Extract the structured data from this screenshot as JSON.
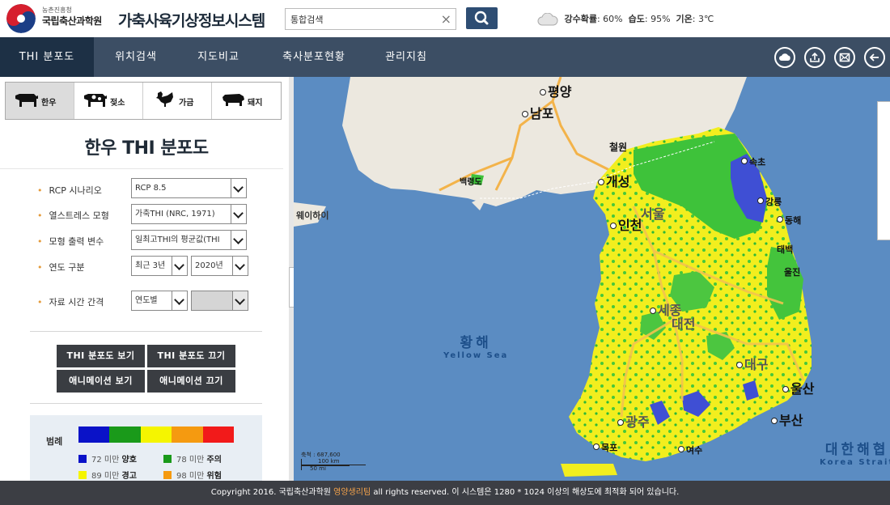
{
  "header": {
    "org_parent": "농촌진흥청",
    "org_name": "국립축산과학원",
    "system_title": "가축사육기상정보시스템",
    "search_value": "통합검색",
    "weather": {
      "precip_label": "강수확률",
      "precip_value": ": 60%",
      "humidity_label": "습도",
      "humidity_value": ": 95%",
      "temp_label": "기온",
      "temp_value": ": 3℃"
    }
  },
  "nav": {
    "tabs": [
      {
        "label": "THI 분포도"
      },
      {
        "label": "위치검색"
      },
      {
        "label": "지도비교"
      },
      {
        "label": "축사분포현황"
      },
      {
        "label": "관리지침"
      }
    ]
  },
  "sidebar": {
    "animals": [
      {
        "label": "한우"
      },
      {
        "label": "젖소"
      },
      {
        "label": "가금"
      },
      {
        "label": "돼지"
      }
    ],
    "panel_title": "한우 THI 분포도",
    "fields": {
      "rcp_label": "RCP 시나리오",
      "rcp_value": "RCP 8.5",
      "stress_label": "열스트레스 모형",
      "stress_value": "가축THI (NRC, 1971)",
      "output_label": "모형 출력 변수",
      "output_value": "일최고THI의 평균값(THI",
      "year_label": "연도 구분",
      "year_range_value": "최근 3년",
      "year_value": "2020년",
      "interval_label": "자료 시간 간격",
      "interval_value": "연도별",
      "interval_sub_value": ""
    },
    "buttons": {
      "show_thi": "THI 분포도 보기",
      "hide_thi": "THI 분포도 끄기",
      "show_anim": "애니메이션 보기",
      "hide_anim": "애니메이션 끄기"
    },
    "legend": {
      "label": "범례",
      "colors": [
        "#0a12c8",
        "#1a9a1a",
        "#f5f500",
        "#f59a10",
        "#f21a1a"
      ],
      "items": [
        {
          "text": "72 미만",
          "level": "양호",
          "color": "#0a12c8"
        },
        {
          "text": "78 미만",
          "level": "주의",
          "color": "#1a9a1a"
        },
        {
          "text": "89 미만",
          "level": "경고",
          "color": "#f5f500"
        },
        {
          "text": "98 미만",
          "level": "위험",
          "color": "#f59a10"
        }
      ]
    }
  },
  "map": {
    "places": {
      "pyongyang": "평양",
      "nampo": "남포",
      "cheorwon": "철원",
      "baengnyeong": "백령도",
      "kaesong": "개성",
      "sokcho": "속초",
      "gangneung": "강릉",
      "donghae": "동해",
      "incheon": "인천",
      "seoul": "서울",
      "weihai": "웨이하이",
      "taebaek": "태백",
      "uljin": "울진",
      "sejong": "세종",
      "daejeon": "대전",
      "daegu": "대구",
      "ulsan": "울산",
      "busan": "부산",
      "gwangju": "광주",
      "mokpo": "목포",
      "yeosu": "여수"
    },
    "seas": {
      "yellow_ko": "황해",
      "yellow_en": "Yellow Sea",
      "east_ko": "대한해협",
      "east_en": "Korea Strait"
    },
    "scale": {
      "scale_text": "축척 : 687,600",
      "km_label": "100 km",
      "mi_label": "50 mi"
    }
  },
  "footer": {
    "copyright_prefix": "Copyright 2016. 국립축산과학원",
    "team": "영양생리팀",
    "copyright_suffix": "all rights reserved. 이 시스템은 1280 * 1024 이상의 해상도에 최적화 되어 있습니다."
  }
}
